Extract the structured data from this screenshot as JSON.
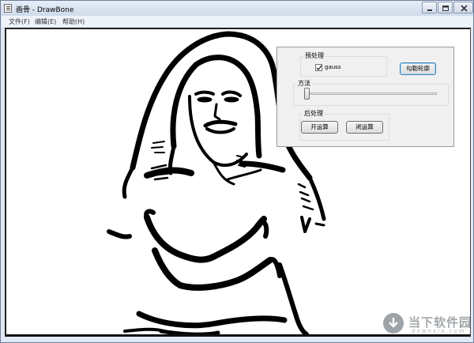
{
  "window": {
    "title": "画骨 - DrawBone"
  },
  "menu": {
    "items": [
      {
        "label": "文件(F)"
      },
      {
        "label": "编辑(E)"
      },
      {
        "label": "帮助(H)"
      }
    ]
  },
  "panel": {
    "preprocess": {
      "label": "预处理",
      "gauss_label": "gauss",
      "gauss_checked": true
    },
    "outline_button": "勾勒轮廓",
    "method": {
      "label": "方法",
      "slider_value": 0
    },
    "postprocess": {
      "label": "后处理",
      "open_button": "开运算",
      "close_button": "闭运算"
    }
  },
  "watermark": {
    "text": "当下软件园",
    "sub": "downxia.com"
  }
}
